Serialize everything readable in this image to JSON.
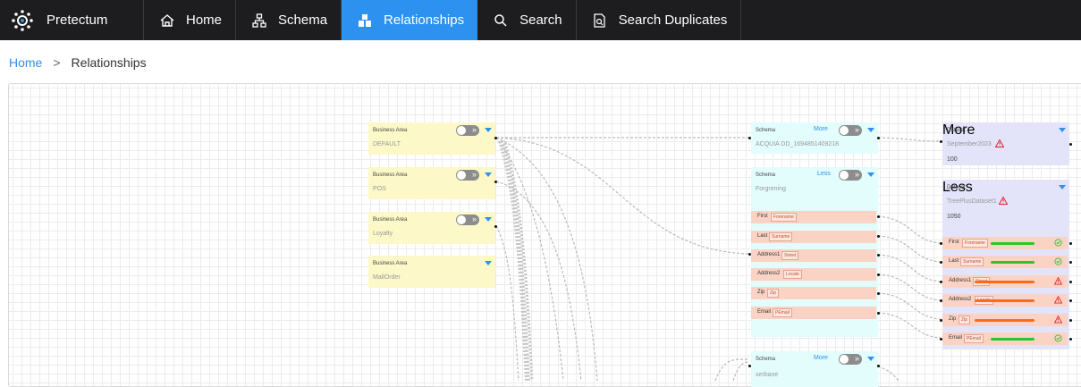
{
  "app": {
    "title": "Pretectum"
  },
  "nav": {
    "home": "Home",
    "schema": "Schema",
    "relationships": "Relationships",
    "search": "Search",
    "search_duplicates": "Search Duplicates"
  },
  "breadcrumb": {
    "home": "Home",
    "separator": ">",
    "current": "Relationships"
  },
  "business_areas": [
    {
      "type": "Business Area",
      "name": "DEFAULT"
    },
    {
      "type": "Business Area",
      "name": "POS"
    },
    {
      "type": "Business Area",
      "name": "Loyalty"
    },
    {
      "type": "Business Area",
      "name": "MailOrder"
    }
  ],
  "schemas": [
    {
      "type": "Schema",
      "name": "ACQUIA DD_1694851409218",
      "toggle_label": "More"
    },
    {
      "type": "Schema",
      "name": "Forgrening",
      "toggle_label": "Less",
      "fields": [
        {
          "label": "First",
          "tag": "Forename"
        },
        {
          "label": "Last",
          "tag": "Surname"
        },
        {
          "label": "Address1",
          "tag": "Street"
        },
        {
          "label": "Address2",
          "tag": "Locale"
        },
        {
          "label": "Zip",
          "tag": "Zip"
        },
        {
          "label": "Email",
          "tag": "PEmail"
        }
      ]
    },
    {
      "type": "Schema",
      "name": "serbane",
      "toggle_label": "More"
    }
  ],
  "datasets": [
    {
      "type": "Dataset",
      "name": "September2023",
      "count": "100",
      "toggle_label": "More"
    },
    {
      "type": "Dataset",
      "name": "TreePlusDataset1",
      "count": "1050",
      "toggle_label": "Less",
      "fields": [
        {
          "label": "First",
          "tag": "Forename",
          "quality": 1.0,
          "status": "ok"
        },
        {
          "label": "Last",
          "tag": "Surname",
          "quality": 1.0,
          "status": "ok"
        },
        {
          "label": "Address1",
          "tag": "Street",
          "quality": 1.0,
          "status": "warning"
        },
        {
          "label": "Address2",
          "tag": "Locale",
          "quality": 1.0,
          "status": "warning"
        },
        {
          "label": "Zip",
          "tag": "Zip",
          "quality": 1.0,
          "status": "warning"
        },
        {
          "label": "Email",
          "tag": "PEmail",
          "quality": 1.0,
          "status": "ok"
        }
      ]
    }
  ],
  "colors": {
    "accent": "#2d91f0",
    "ok": "#2ec42e",
    "warning": "#ff6a1a",
    "alert": "#e0242d"
  }
}
